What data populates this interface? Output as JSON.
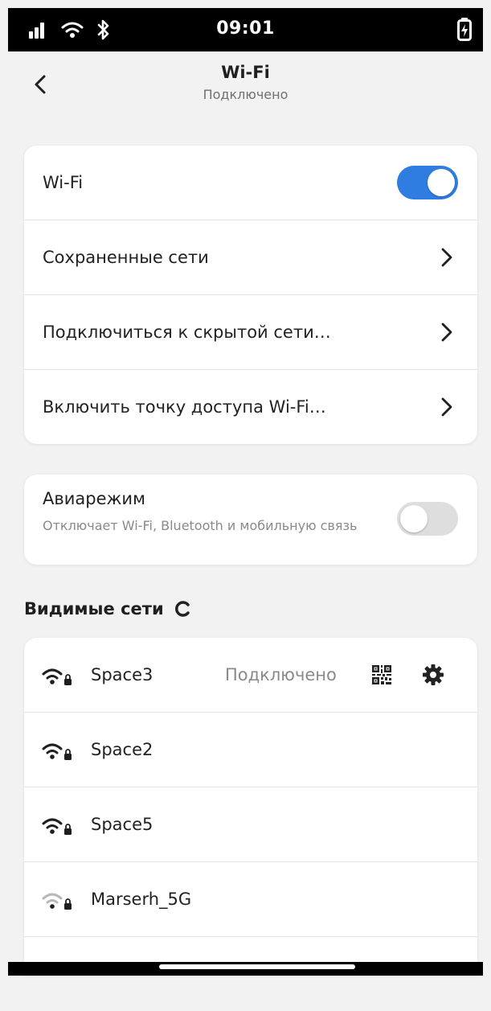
{
  "status_bar": {
    "time": "09:01",
    "icons": [
      "signal-icon",
      "wifi-icon",
      "bluetooth-icon",
      "battery-charging-icon"
    ]
  },
  "header": {
    "title": "Wi-Fi",
    "subtitle": "Подключено",
    "back_icon": "chevron-left-icon"
  },
  "wifi_card": {
    "wifi_label": "Wi-Fi",
    "wifi_enabled": true,
    "saved_networks": "Сохраненные сети",
    "hidden_network": "Подключиться к скрытой сети…",
    "hotspot": "Включить точку доступа Wi-Fi…"
  },
  "airplane": {
    "title": "Авиарежим",
    "description": "Отключает Wi-Fi, Bluetooth и мобильную связь",
    "enabled": false
  },
  "visible_networks": {
    "title": "Видимые сети",
    "networks": [
      {
        "name": "Space3",
        "status": "Подключено",
        "signal": "strong",
        "secured": true
      },
      {
        "name": "Space2",
        "status": "",
        "signal": "strong",
        "secured": true
      },
      {
        "name": "Space5",
        "status": "",
        "signal": "strong",
        "secured": true
      },
      {
        "name": "Marserh_5G",
        "status": "",
        "signal": "weak",
        "secured": true
      }
    ]
  },
  "colors": {
    "accent": "#2f7de1",
    "background": "#f2f2f2",
    "secondary_text": "#8a8a8a"
  }
}
